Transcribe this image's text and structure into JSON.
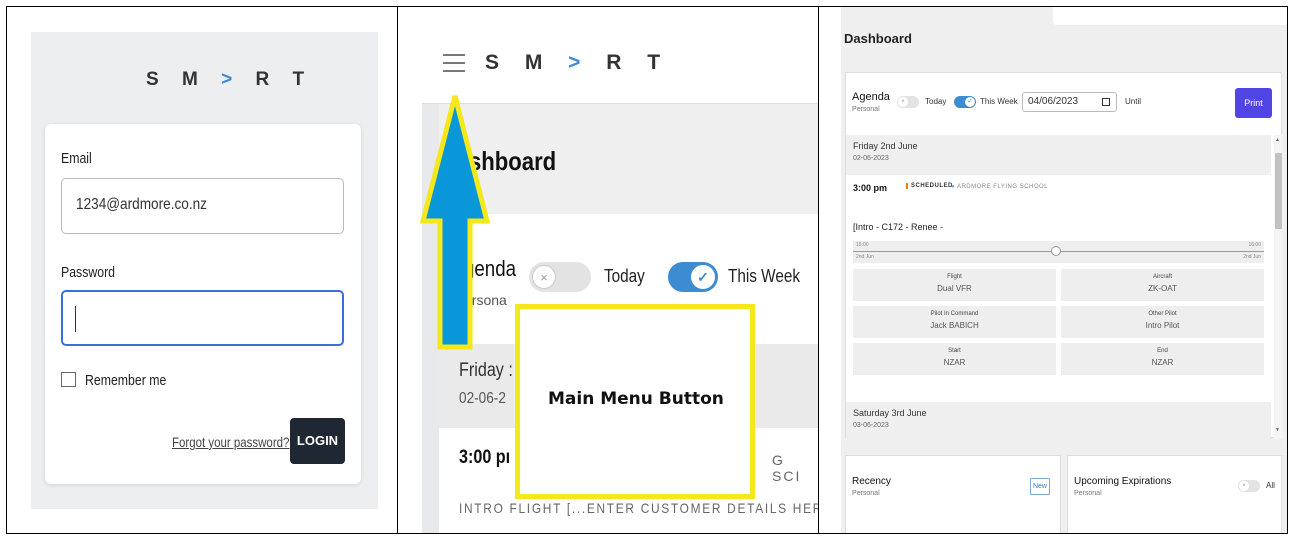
{
  "colors": {
    "accent": "#3d8bd0",
    "login_button": "#1f2733",
    "print_button": "#5145e6",
    "annotation": "#f4e71a",
    "arrow": "#0a97d9"
  },
  "logo": {
    "text_before": "S M ",
    "chevron": ">",
    "text_after": " R T"
  },
  "login": {
    "email_label": "Email",
    "email_value": "1234@ardmore.co.nz",
    "password_label": "Password",
    "password_value": "",
    "remember_label": "Remember me",
    "forgot_link": "Forgot your password?",
    "login_button": "LOGIN"
  },
  "zoomed": {
    "dashboard_title": "shboard",
    "agenda_title": "genda",
    "personal": "ersona",
    "today": "Today",
    "this_week": "This Week",
    "day_title": "Friday :",
    "day_date": "02-06-2",
    "time": "3:00 pı",
    "intro": "INTRO FLIGHT [...ENTER CUSTOMER DETAILS HERE L.",
    "school_fragment": "G SCI",
    "annotation_label": "Main Menu Button"
  },
  "dashboard": {
    "title": "Dashboard",
    "agenda": "Agenda",
    "personal": "Personal",
    "today": "Today",
    "this_week": "This Week",
    "date_value": "04/06/2023",
    "until": "Until",
    "print": "Print",
    "day1_title": "Friday 2nd June",
    "day1_date": "02-06-2023",
    "event_time": "3:00 pm",
    "event_status": "SCHEDULED",
    "event_location": "ARDMORE FLYING SCHOOL",
    "event_title": "[Intro - C172 - Renee -",
    "timeline": {
      "start_time": "15:00",
      "start_day": "2nd Jun",
      "end_time": "16:00",
      "end_day": "2nd Jun"
    },
    "details": [
      {
        "label": "Flight",
        "value": "Dual VFR"
      },
      {
        "label": "Aircraft",
        "value": "ZK-OAT"
      },
      {
        "label": "Pilot In Command",
        "value": "Jack BABICH"
      },
      {
        "label": "Other Pilot",
        "value": "Intro Pilot"
      },
      {
        "label": "Start",
        "value": "NZAR"
      },
      {
        "label": "End",
        "value": "NZAR"
      }
    ],
    "day2_title": "Saturday 3rd June",
    "day2_date": "03-06-2023",
    "recency_title": "Recency",
    "recency_sub": "Personal",
    "new_button": "New",
    "expirations_title": "Upcoming Expirations",
    "expirations_sub": "Personal",
    "all_label": "All"
  }
}
